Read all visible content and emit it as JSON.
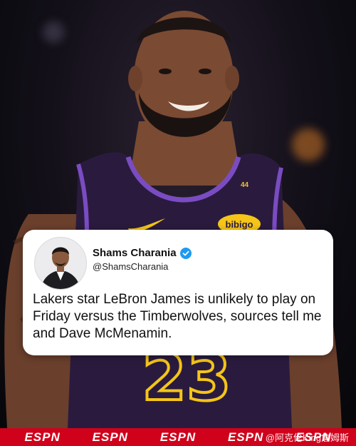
{
  "tweet_card": {
    "display_name": "Shams Charania",
    "handle": "@ShamsCharania",
    "text": "Lakers star LeBron James is unlikely to play on Friday versus the Timberwolves, sources tell me and Dave McMenamin."
  },
  "jersey": {
    "number": "23",
    "patch_text": "bibigo",
    "collar_number": "44"
  },
  "footer": {
    "logos": [
      "ESPN",
      "ESPN",
      "ESPN",
      "ESPN",
      "ESPN"
    ],
    "watermark": "@阿克伦King詹姆斯"
  },
  "colors": {
    "brand_red": "#d0021b",
    "jersey_purple": "#2a1b3e",
    "trim_purple": "#7a4cc2",
    "verified_blue": "#1d9bf0"
  }
}
